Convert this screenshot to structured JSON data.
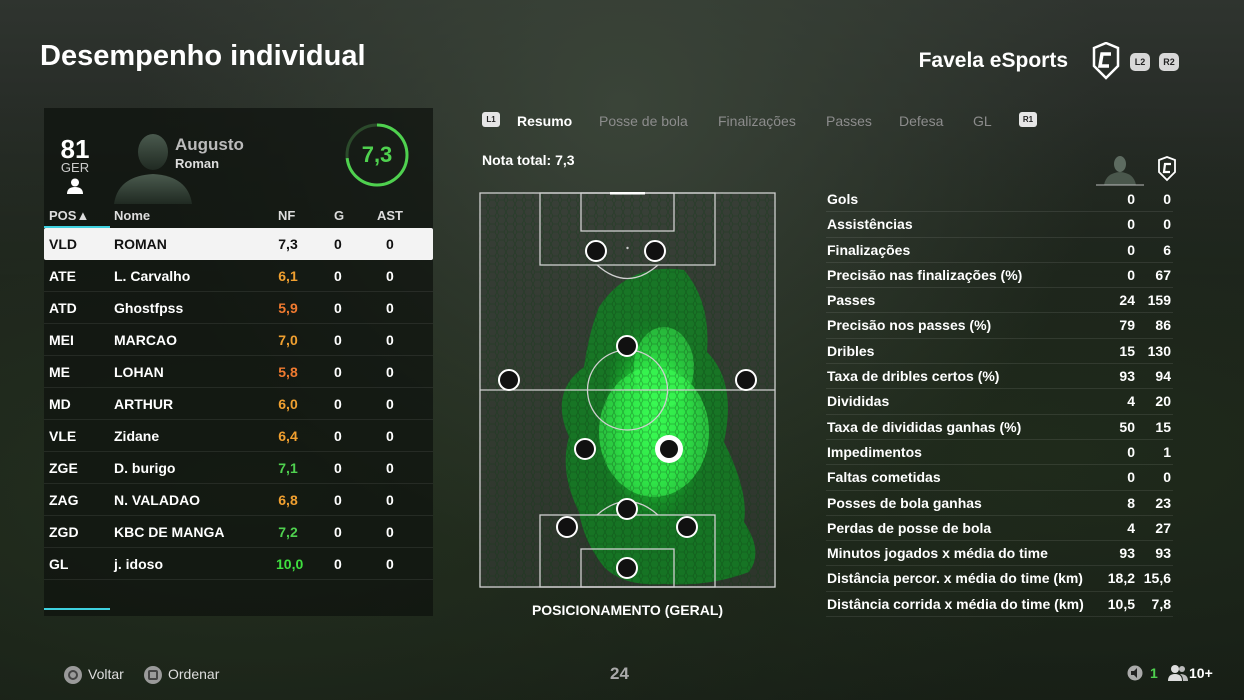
{
  "header": {
    "title": "Desempenho individual",
    "club": "Favela eSports",
    "btn_l2": "L2",
    "btn_r2": "R2"
  },
  "player": {
    "overall": "81",
    "overall_pos": "GER",
    "first_name": "Augusto",
    "last_name": "Roman",
    "rating": "7,3",
    "rating_color": "#4fd14f"
  },
  "table": {
    "headers": {
      "pos": "POS▲",
      "name": "Nome",
      "nf": "NF",
      "g": "G",
      "ast": "AST"
    },
    "rows": [
      {
        "pos": "VLD",
        "name": "ROMAN",
        "nf": "7,3",
        "g": "0",
        "ast": "0",
        "color": "#111111"
      },
      {
        "pos": "ATE",
        "name": "L. Carvalho",
        "nf": "6,1",
        "g": "0",
        "ast": "0",
        "color": "#f0a030"
      },
      {
        "pos": "ATD",
        "name": "Ghostfpss",
        "nf": "5,9",
        "g": "0",
        "ast": "0",
        "color": "#f07a30"
      },
      {
        "pos": "MEI",
        "name": "MARCAO",
        "nf": "7,0",
        "g": "0",
        "ast": "0",
        "color": "#f0a030"
      },
      {
        "pos": "ME",
        "name": "LOHAN",
        "nf": "5,8",
        "g": "0",
        "ast": "0",
        "color": "#f07a30"
      },
      {
        "pos": "MD",
        "name": "ARTHUR",
        "nf": "6,0",
        "g": "0",
        "ast": "0",
        "color": "#f0a030"
      },
      {
        "pos": "VLE",
        "name": "Zidane",
        "nf": "6,4",
        "g": "0",
        "ast": "0",
        "color": "#f0a030"
      },
      {
        "pos": "ZGE",
        "name": "D. burigo",
        "nf": "7,1",
        "g": "0",
        "ast": "0",
        "color": "#4fd14f"
      },
      {
        "pos": "ZAG",
        "name": "N. VALADAO",
        "nf": "6,8",
        "g": "0",
        "ast": "0",
        "color": "#f0a030"
      },
      {
        "pos": "ZGD",
        "name": "KBC DE MANGA",
        "nf": "7,2",
        "g": "0",
        "ast": "0",
        "color": "#4fd14f"
      },
      {
        "pos": "GL",
        "name": "j. idoso",
        "nf": "10,0",
        "g": "0",
        "ast": "0",
        "color": "#3fe03f"
      }
    ]
  },
  "tabs": {
    "l1": "L1",
    "r1": "R1",
    "items": [
      "Resumo",
      "Posse de bola",
      "Finalizações",
      "Passes",
      "Defesa",
      "GL"
    ],
    "active": 0
  },
  "nota_total": "Nota total: 7,3",
  "pitch_label": "POSICIONAMENTO (GERAL)",
  "stats": [
    {
      "label": "Gols",
      "player": "0",
      "team": "0"
    },
    {
      "label": "Assistências",
      "player": "0",
      "team": "0"
    },
    {
      "label": "Finalizações",
      "player": "0",
      "team": "6"
    },
    {
      "label": "Precisão nas finalizações (%)",
      "player": "0",
      "team": "67"
    },
    {
      "label": "Passes",
      "player": "24",
      "team": "159"
    },
    {
      "label": "Precisão nos passes (%)",
      "player": "79",
      "team": "86"
    },
    {
      "label": "Dribles",
      "player": "15",
      "team": "130"
    },
    {
      "label": "Taxa de dribles certos (%)",
      "player": "93",
      "team": "94"
    },
    {
      "label": "Divididas",
      "player": "4",
      "team": "20"
    },
    {
      "label": "Taxa de divididas ganhas (%)",
      "player": "50",
      "team": "15"
    },
    {
      "label": "Impedimentos",
      "player": "0",
      "team": "1"
    },
    {
      "label": "Faltas cometidas",
      "player": "0",
      "team": "0"
    },
    {
      "label": "Posses de bola ganhas",
      "player": "8",
      "team": "23"
    },
    {
      "label": "Perdas de posse de bola",
      "player": "4",
      "team": "27"
    },
    {
      "label": "Minutos jogados x média do time",
      "player": "93",
      "team": "93"
    },
    {
      "label": "Distância percor. x média do time (km)",
      "player": "18,2",
      "team": "15,6"
    },
    {
      "label": "Distância corrida x média do time (km)",
      "player": "10,5",
      "team": "7,8"
    }
  ],
  "footer": {
    "back": "Voltar",
    "sort": "Ordenar",
    "page": "24",
    "online_count": "1",
    "players_count": "10+"
  }
}
